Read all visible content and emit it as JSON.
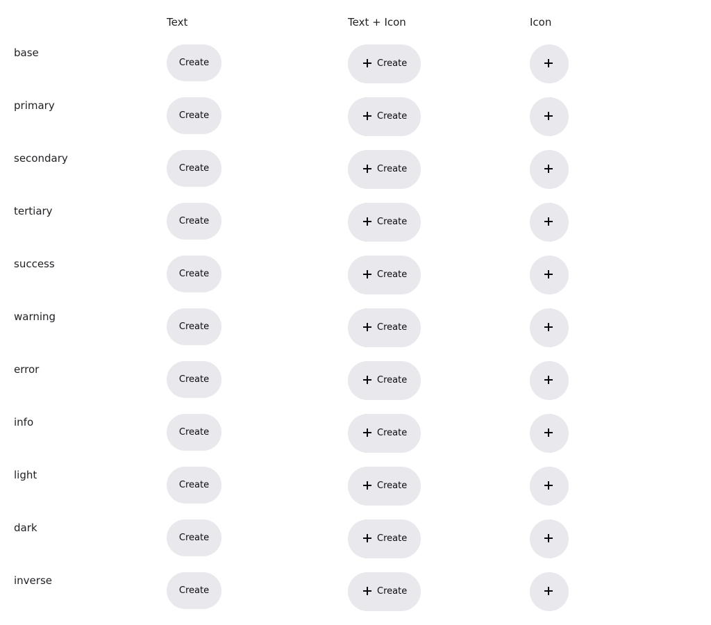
{
  "headers": {
    "text": "Text",
    "text_icon": "Text + Icon",
    "icon": "Icon"
  },
  "button_label": "Create",
  "button_icon": "plus-icon",
  "colors": {
    "button_bg": "#e8e8ed",
    "text": "#1f1f24"
  },
  "rows": [
    {
      "label": "base"
    },
    {
      "label": "primary"
    },
    {
      "label": "secondary"
    },
    {
      "label": "tertiary"
    },
    {
      "label": "success"
    },
    {
      "label": "warning"
    },
    {
      "label": "error"
    },
    {
      "label": "info"
    },
    {
      "label": "light"
    },
    {
      "label": "dark"
    },
    {
      "label": "inverse"
    }
  ]
}
